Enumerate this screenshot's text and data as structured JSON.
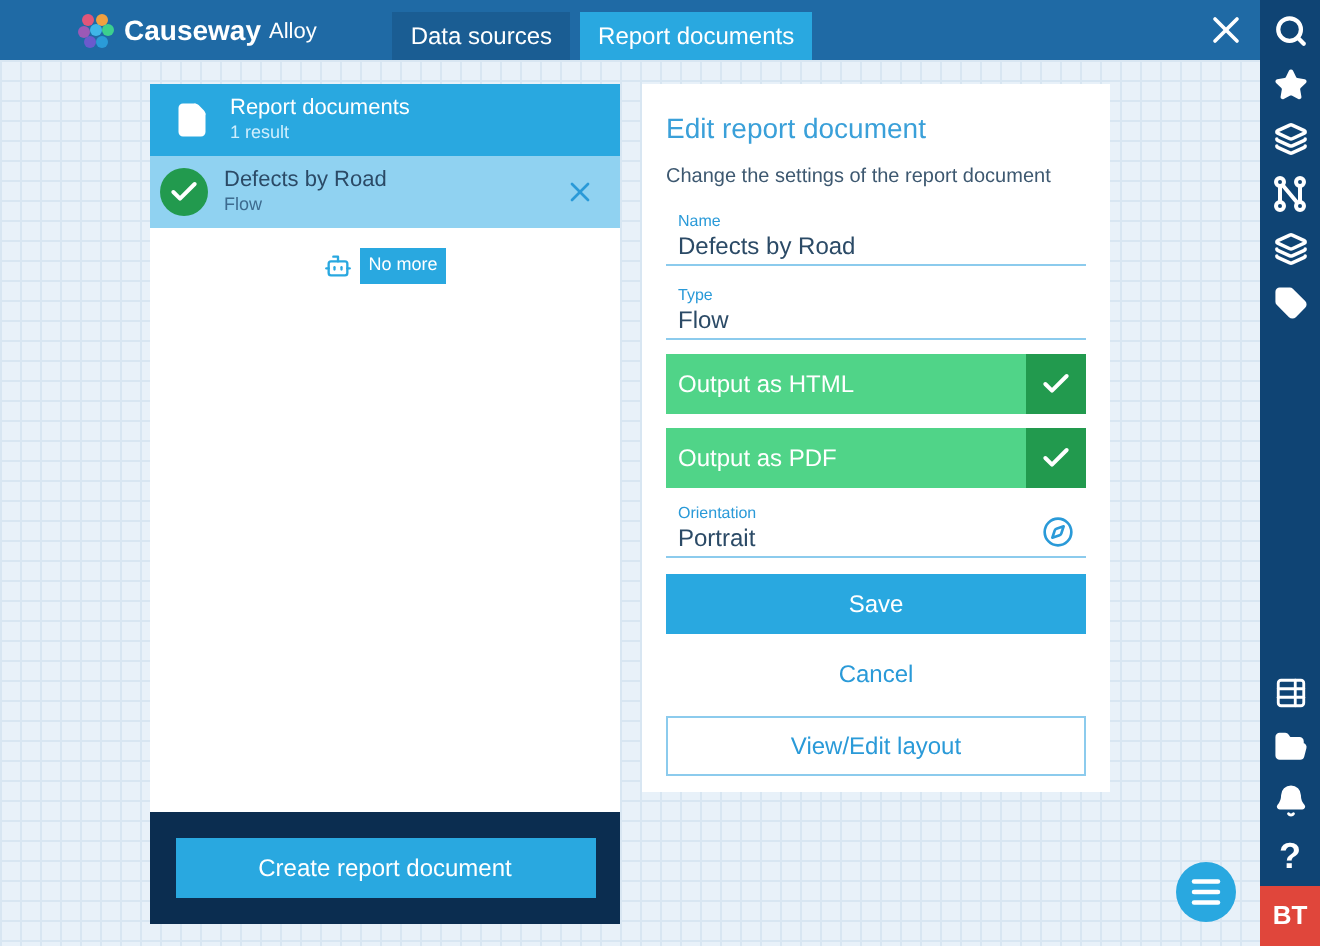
{
  "header": {
    "logo_text": "Causeway",
    "logo_suffix": "Alloy",
    "tabs": [
      {
        "label": "Data sources",
        "selected": false
      },
      {
        "label": "Report documents",
        "selected": true
      }
    ]
  },
  "list_panel": {
    "title": "Report documents",
    "subtitle": "1 result",
    "items": [
      {
        "title": "Defects by Road",
        "subtitle": "Flow",
        "selected": true
      }
    ],
    "end_label": "No more",
    "create_button": "Create report document"
  },
  "edit_panel": {
    "title": "Edit report document",
    "description": "Change the settings of the report document",
    "fields": [
      {
        "label": "Name",
        "value": "Defects by Road"
      },
      {
        "label": "Type",
        "value": "Flow"
      }
    ],
    "toggles": [
      {
        "label": "Output as HTML",
        "checked": true
      },
      {
        "label": "Output as PDF",
        "checked": true
      }
    ],
    "orientation": {
      "label": "Orientation",
      "value": "Portrait"
    },
    "save": "Save",
    "cancel": "Cancel",
    "layout": "View/Edit layout"
  },
  "sidebar": {
    "help": "?",
    "avatar": "BT"
  }
}
